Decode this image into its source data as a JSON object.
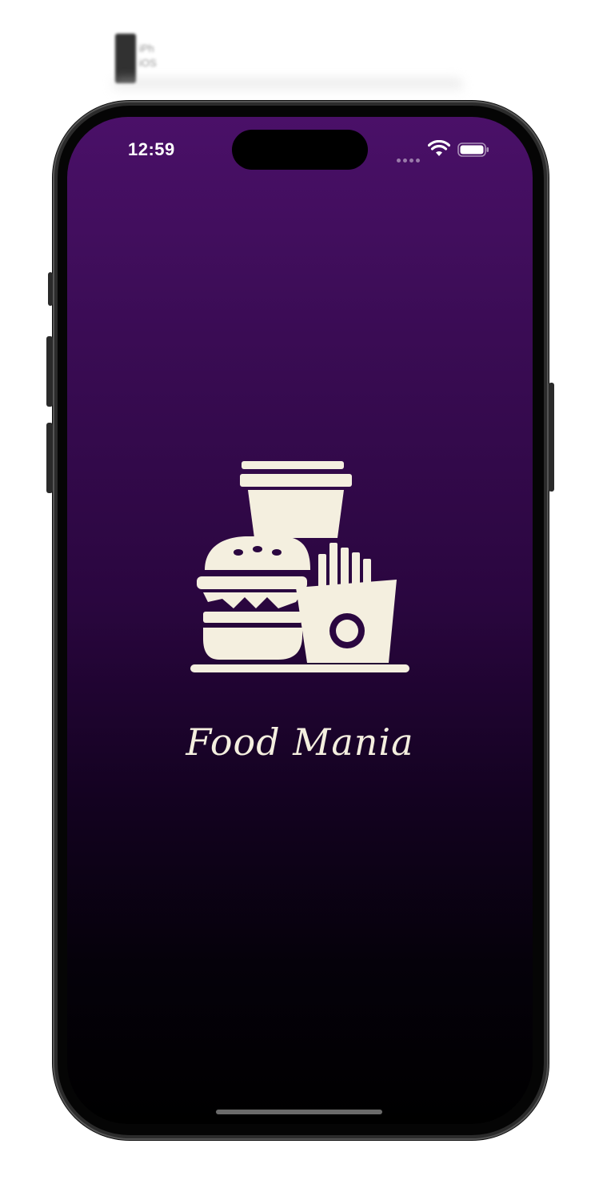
{
  "simulator_label": {
    "device": "iPh",
    "os": "iOS"
  },
  "status_bar": {
    "time": "12:59",
    "icons": [
      "cellular-signal-icon",
      "wifi-icon",
      "battery-icon"
    ]
  },
  "splash": {
    "logo_icon": "fast-food-combo-icon",
    "app_name": "Food Mania"
  },
  "colors": {
    "gradient_top": "#4a1068",
    "gradient_bottom": "#000000",
    "logo_fill": "#f4efdf"
  }
}
